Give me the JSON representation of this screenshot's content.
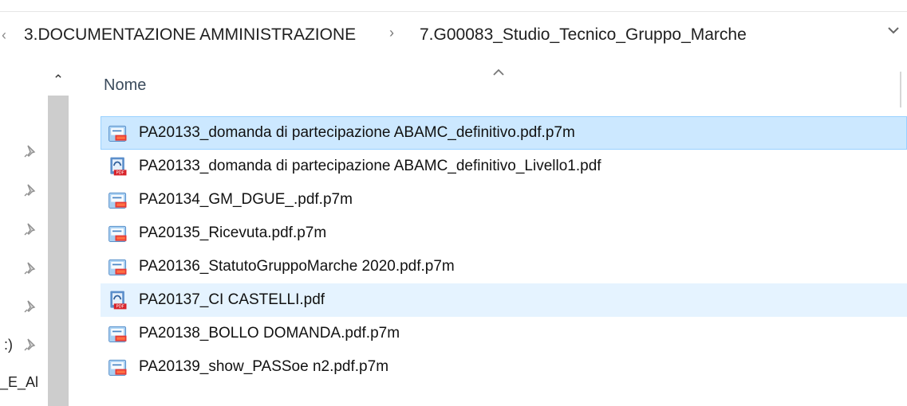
{
  "address": {
    "path": [
      "3.DOCUMENTAZIONE AMMINISTRAZIONE",
      "7.G00083_Studio_Tecnico_Gruppo_Marche"
    ],
    "separator": ">"
  },
  "navigation": {
    "partial_labels": [
      ":)",
      "_E_Al"
    ]
  },
  "list": {
    "column_header": "Nome",
    "files": [
      {
        "name": "PA20133_domanda di partecipazione ABAMC_definitivo.pdf.p7m",
        "icon": "signed-pdf-icon",
        "state": "selected"
      },
      {
        "name": "PA20133_domanda di partecipazione ABAMC_definitivo_Livello1.pdf",
        "icon": "pdf-icon",
        "state": "normal"
      },
      {
        "name": "PA20134_GM_DGUE_.pdf.p7m",
        "icon": "signed-pdf-icon",
        "state": "normal"
      },
      {
        "name": "PA20135_Ricevuta.pdf.p7m",
        "icon": "signed-pdf-icon",
        "state": "normal"
      },
      {
        "name": "PA20136_StatutoGruppoMarche 2020.pdf.p7m",
        "icon": "signed-pdf-icon",
        "state": "normal"
      },
      {
        "name": "PA20137_CI CASTELLI.pdf",
        "icon": "pdf-icon",
        "state": "hover"
      },
      {
        "name": "PA20138_BOLLO DOMANDA.pdf.p7m",
        "icon": "signed-pdf-icon",
        "state": "normal"
      },
      {
        "name": "PA20139_show_PASSoe n2.pdf.p7m",
        "icon": "signed-pdf-icon",
        "state": "normal"
      }
    ]
  },
  "colors": {
    "selected_bg": "#cce8ff",
    "selected_border": "#99d1ff",
    "hover_bg": "#e5f3ff"
  }
}
